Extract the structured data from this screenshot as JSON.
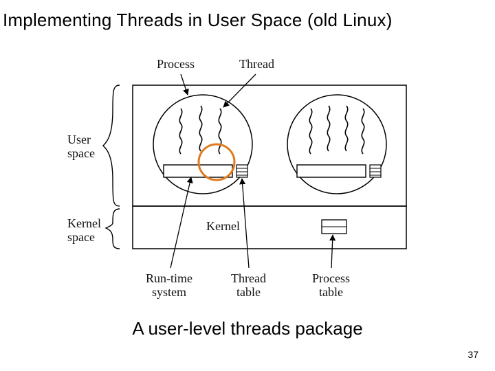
{
  "title": "Implementing Threads in User Space (old Linux)",
  "caption": "A user-level threads package",
  "page_number": "37",
  "labels": {
    "process": "Process",
    "thread": "Thread",
    "user_space": "User\nspace",
    "kernel_space": "Kernel\nspace",
    "kernel": "Kernel",
    "runtime_system": "Run-time\nsystem",
    "thread_table": "Thread\ntable",
    "process_table": "Process\ntable"
  }
}
